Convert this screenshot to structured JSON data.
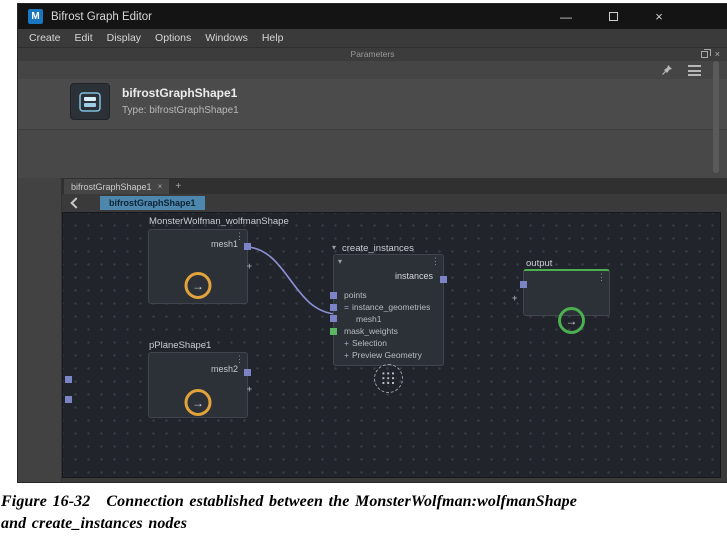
{
  "window": {
    "title": "Bifrost Graph Editor"
  },
  "icons": {
    "minimize": "—",
    "close": "×",
    "menu_dots": "⋮",
    "collapse": "▾",
    "plus": "+",
    "arrow": "→",
    "tab_close": "×",
    "add_tab": "+"
  },
  "menubar": {
    "items": [
      "Create",
      "Edit",
      "Display",
      "Options",
      "Windows",
      "Help"
    ]
  },
  "parameters": {
    "header": "Parameters",
    "node_name": "bifrostGraphShape1",
    "node_type": "Type: bifrostGraphShape1"
  },
  "tabs": {
    "active": "bifrostGraphShape1"
  },
  "breadcrumb": {
    "current": "bifrostGraphShape1"
  },
  "graph": {
    "monster": {
      "title": "MonsterWolfman_wolfmanShape",
      "out_port": "mesh1"
    },
    "pplane": {
      "title": "pPlaneShape1",
      "out_port": "mesh2"
    },
    "create": {
      "title": "create_instances",
      "out_port": "instances",
      "rows": [
        {
          "prefix": "",
          "label": "points"
        },
        {
          "prefix": "=",
          "label": "instance_geometries"
        },
        {
          "prefix": "",
          "label": "mesh1"
        },
        {
          "prefix": "",
          "label": "mask_weights"
        },
        {
          "prefix": "+",
          "label": "Selection"
        },
        {
          "prefix": "+",
          "label": "Preview Geometry"
        }
      ]
    },
    "output": {
      "title": "output"
    }
  },
  "caption": {
    "figure": "Figure 16-32",
    "line1": "Connection established between the MonsterWolfman:wolfmanShape",
    "line2": "and create_instances nodes"
  },
  "colors": {
    "port_blue": "#7c84c8",
    "port_green": "#5cb661",
    "circle_yellow": "#e2a33c",
    "circle_green": "#4caf50",
    "wire": "#8d92d8",
    "breadcrumb_active": "#4e87ad",
    "canvas_bg": "#21252b"
  }
}
